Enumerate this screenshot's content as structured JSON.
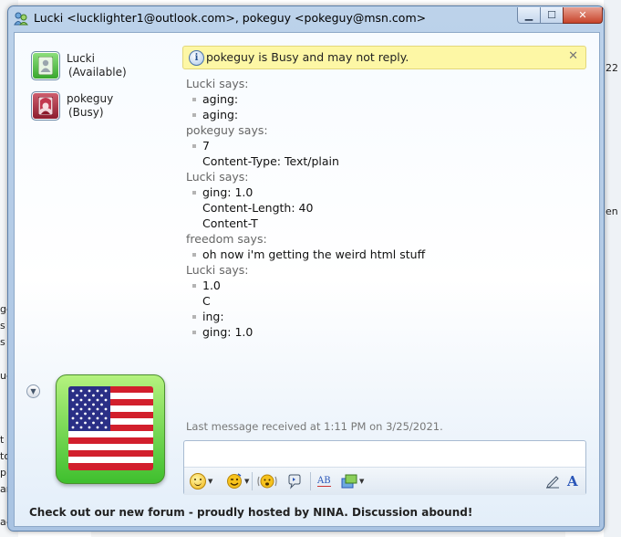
{
  "window": {
    "title": "Lucki <lucklighter1@outlook.com>, pokeguy <pokeguy@msn.com>",
    "minimize_glyph": "▁",
    "maximize_glyph": "☐",
    "close_glyph": "✕"
  },
  "contacts": [
    {
      "name": "Lucki",
      "status": "(Available)",
      "avatar": "default-user-icon",
      "color": "#3aa72e"
    },
    {
      "name": "pokeguy",
      "status": "(Busy)",
      "avatar": "user-picture",
      "color": "#b8283c"
    }
  ],
  "infobar": {
    "icon": "info-icon",
    "text": "pokeguy is Busy and may not reply.",
    "close_glyph": "✕"
  },
  "conversation": [
    {
      "sender": "Lucki says:",
      "messages": [
        [
          "aging:"
        ],
        [
          "aging:"
        ]
      ]
    },
    {
      "sender": "pokeguy says:",
      "messages": [
        [
          "7",
          "Content-Type: Text/plain"
        ]
      ]
    },
    {
      "sender": "Lucki says:",
      "messages": [
        [
          "ging: 1.0",
          "Content-Length: 40",
          "Content-T"
        ]
      ]
    },
    {
      "sender": "freedom says:",
      "messages": [
        [
          "oh now i'm getting the weird html stuff"
        ]
      ]
    },
    {
      "sender": "Lucki says:",
      "messages": [
        [
          "1.0",
          "C"
        ],
        [
          "ing:"
        ],
        [
          "ging: 1.0"
        ]
      ]
    }
  ],
  "last_message": "Last message received at 1:11 PM on 3/25/2021.",
  "toolbar": {
    "items": [
      "emoticon-icon",
      "wink-icon",
      "nudge-icon",
      "voice-clip-icon",
      "spell-check-icon",
      "background-icon",
      "handwriting-icon",
      "font-icon"
    ],
    "font_glyph": "A",
    "spell_glyph": "AB"
  },
  "footer": "Check out our new forum - proudly hosted by NINA. Discussion abound!",
  "colors": {
    "accent": "#2a56b8",
    "infobar": "#fdf7a5",
    "frame": "#a9c3e2"
  }
}
